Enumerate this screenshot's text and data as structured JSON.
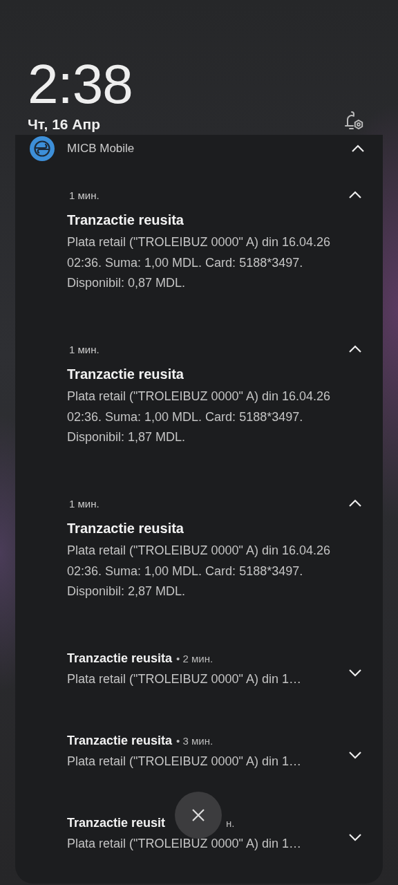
{
  "lockscreen": {
    "time": "2:38",
    "date": "Чт, 16 Апр"
  },
  "app": {
    "name": "MICB Mobile",
    "expanded": true
  },
  "notifications": [
    {
      "expanded": true,
      "time": "1 мин.",
      "title": "Tranzactie reusita",
      "body": "Plata retail (\"TROLEIBUZ 0000\" A) din 16.04.26\n02:36. Suma: 1,00 MDL. Card: 5188*3497.\nDisponibil: 0,87 MDL."
    },
    {
      "expanded": true,
      "time": "1 мин.",
      "title": "Tranzactie reusita",
      "body": "Plata retail (\"TROLEIBUZ 0000\" A) din 16.04.26\n02:36. Suma: 1,00 MDL. Card: 5188*3497.\nDisponibil: 1,87 MDL."
    },
    {
      "expanded": true,
      "time": "1 мин.",
      "title": "Tranzactie reusita",
      "body": "Plata retail (\"TROLEIBUZ 0000\" A) din 16.04.26\n02:36. Suma: 1,00 MDL. Card: 5188*3497.\nDisponibil: 2,87 MDL."
    },
    {
      "expanded": false,
      "time": "• 2 мин.",
      "title": "Tranzactie reusita",
      "body": "Plata retail (\"TROLEIBUZ 0000\" A) din 1…"
    },
    {
      "expanded": false,
      "time": "• 3 мин.",
      "title": "Tranzactie reusita",
      "body": "Plata retail (\"TROLEIBUZ 0000\" A) din 1…"
    },
    {
      "expanded": false,
      "time": "н.",
      "title": "Tranzactie reusit",
      "body": "Plata retail (\"TROLEIBUZ 0000\" A) din 1…"
    }
  ]
}
